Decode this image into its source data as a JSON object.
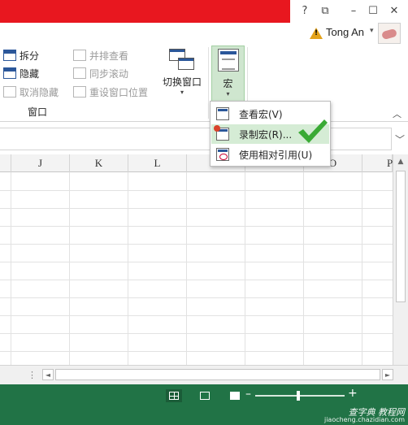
{
  "window": {
    "help": "?",
    "restore_ribbon": "⧉",
    "minimize": "–",
    "maximize": "☐",
    "close": "✕"
  },
  "account": {
    "user_name": "Tong An",
    "caret": "▾"
  },
  "ribbon": {
    "window_group": {
      "split": "拆分",
      "hide": "隐藏",
      "unhide": "取消隐藏",
      "side_by_side": "并排查看",
      "sync_scroll": "同步滚动",
      "reset_position": "重设窗口位置",
      "group_label": "窗口"
    },
    "switch_windows": "切换窗口",
    "macros": "宏",
    "caret": "▾",
    "collapse": "︿"
  },
  "macro_menu": {
    "items": [
      {
        "label": "查看宏(V)"
      },
      {
        "label": "录制宏(R)..."
      },
      {
        "label": "使用相对引用(U)"
      }
    ]
  },
  "formula_bar": {
    "expand": "﹀"
  },
  "grid": {
    "columns": [
      "J",
      "K",
      "L",
      "M",
      "N",
      "O",
      "P"
    ]
  },
  "scroll": {
    "up": "▲",
    "down": "▼",
    "left": "◄",
    "right": "►",
    "sheet_dots": "⋮"
  },
  "status_bar": {
    "zoom_minus": "–",
    "zoom_plus": "+",
    "watermark_main": "查字典 教程网",
    "watermark_sub": "jiaocheng.chazidian.com"
  },
  "colors": {
    "title_red": "#e8171f",
    "excel_green": "#217346",
    "menu_highlight": "#d5ecd5",
    "check_green": "#3aaa35"
  }
}
